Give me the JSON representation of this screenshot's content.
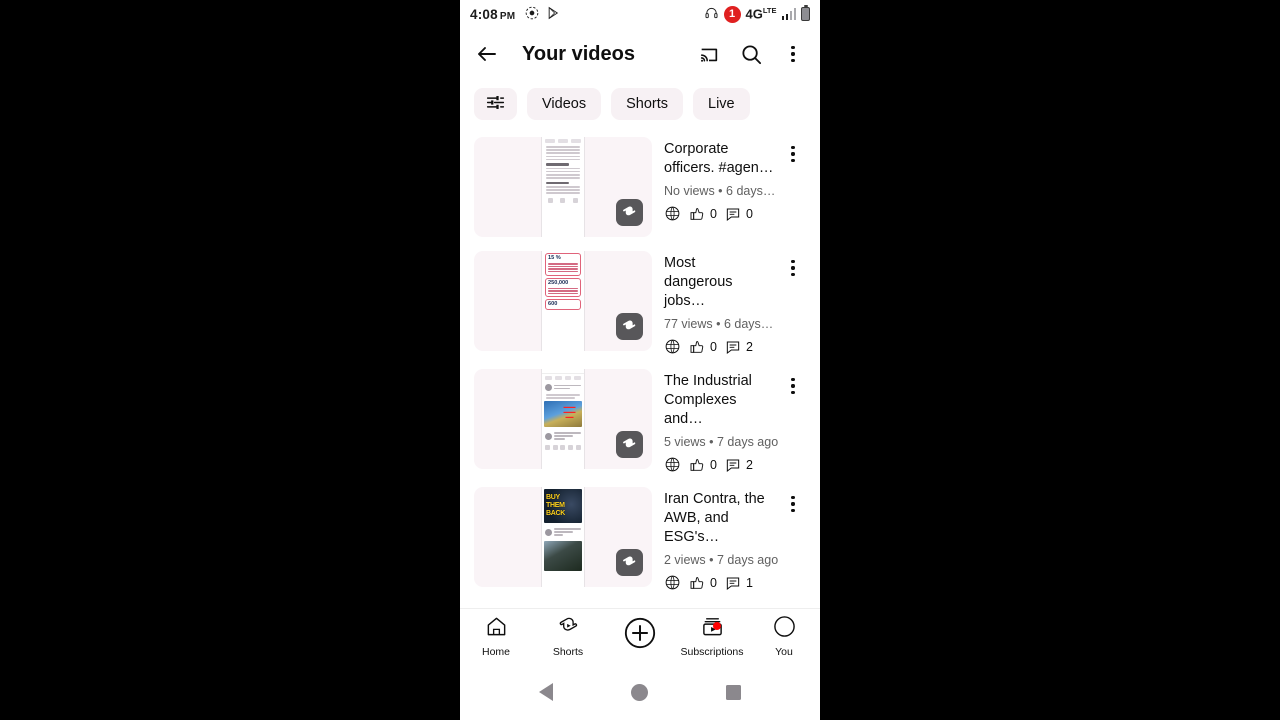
{
  "status_bar": {
    "time": "4:08",
    "ampm": "PM",
    "screen_record_icon": "screen-record-icon",
    "play_store_icon": "play-store-icon",
    "headphones_icon": "headphones-icon",
    "notification_count": "1",
    "network_type": "4G",
    "network_sub": "LTE",
    "signal_icon": "signal-bars-icon",
    "battery_icon": "battery-icon"
  },
  "header": {
    "back_label": "back-arrow",
    "title": "Your videos",
    "cast_label": "cast-icon",
    "search_label": "search-icon",
    "overflow_label": "more-options"
  },
  "chips": [
    {
      "name": "filter",
      "label": "",
      "icon": "filter-sliders-icon"
    },
    {
      "name": "videos",
      "label": "Videos"
    },
    {
      "name": "shorts",
      "label": "Shorts"
    },
    {
      "name": "live",
      "label": "Live"
    }
  ],
  "videos": [
    {
      "title": "Corporate\nofficers. #agen…",
      "subtitle": "No views • 6 days…",
      "visibility": "public",
      "likes": "0",
      "comments": "0",
      "badge": "shorts-badge",
      "thumb_kind": "document"
    },
    {
      "title": "Most\ndangerous jobs…",
      "subtitle": "77 views • 6 days…",
      "visibility": "public",
      "likes": "0",
      "comments": "2",
      "badge": "shorts-badge",
      "thumb_kind": "infographic",
      "thumb_numbers": [
        "15 %",
        "250,000",
        "600"
      ]
    },
    {
      "title": "The Industrial\nComplexes and…",
      "subtitle": "5 views • 7 days ago",
      "visibility": "public",
      "likes": "0",
      "comments": "2",
      "badge": "shorts-badge",
      "thumb_kind": "youtube-app"
    },
    {
      "title": "Iran Contra, the\nAWB, and ESG's…",
      "subtitle": "2 views • 7 days ago",
      "visibility": "public",
      "likes": "0",
      "comments": "1",
      "badge": "shorts-badge",
      "thumb_kind": "buy-them-back",
      "thumb_text": "BUY THEM BACK"
    }
  ],
  "bottom_nav": [
    {
      "label": "Home",
      "icon": "home-icon",
      "badge": false
    },
    {
      "label": "Shorts",
      "icon": "shorts-icon",
      "badge": false
    },
    {
      "label": "",
      "icon": "create-plus-icon",
      "badge": false
    },
    {
      "label": "Subscriptions",
      "icon": "subscriptions-icon",
      "badge": true
    },
    {
      "label": "You",
      "icon": "account-avatar-icon",
      "badge": false
    }
  ],
  "system_nav": {
    "back": "android-back",
    "home": "android-home",
    "recents": "android-recents"
  },
  "colors": {
    "accent_red": "#ff0000",
    "chip_bg": "#f7f1f4",
    "thumb_bg": "#faf4f7",
    "text_primary": "#0f0f0f",
    "text_secondary": "#606060",
    "badge_gray": "#58575a"
  }
}
